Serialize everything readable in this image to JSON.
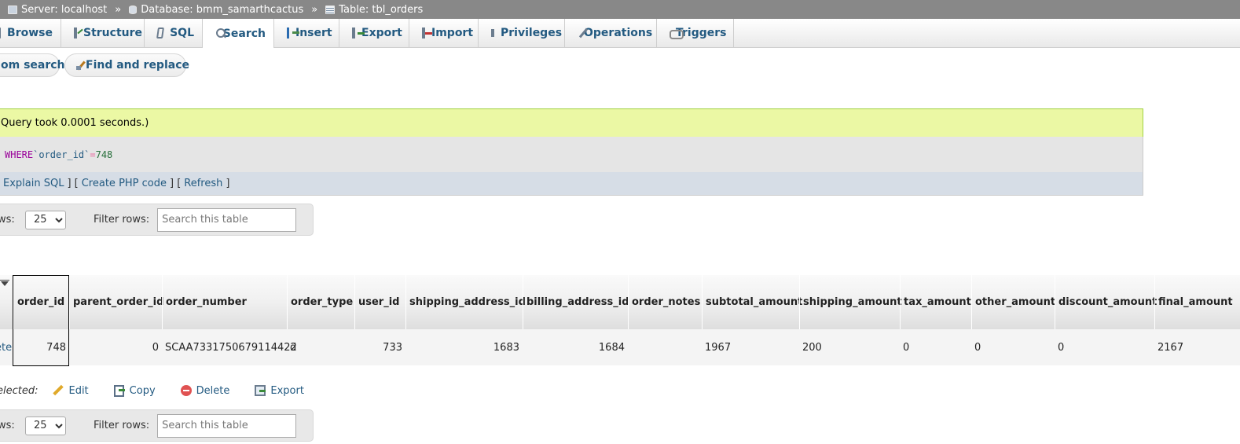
{
  "breadcrumb": {
    "server": "Server: localhost",
    "database": "Database: bmm_samarthcactus",
    "table": "Table: tbl_orders",
    "separator": "»"
  },
  "tabs": [
    {
      "label": "Browse",
      "icon": "browse-icon"
    },
    {
      "label": "Structure",
      "icon": "structure-icon"
    },
    {
      "label": "SQL",
      "icon": "sql-icon"
    },
    {
      "label": "Search",
      "icon": "search-icon",
      "active": true
    },
    {
      "label": "Insert",
      "icon": "insert-icon"
    },
    {
      "label": "Export",
      "icon": "export-icon"
    },
    {
      "label": "Import",
      "icon": "import-icon"
    },
    {
      "label": "Privileges",
      "icon": "privileges-icon"
    },
    {
      "label": "Operations",
      "icon": "operations-icon"
    },
    {
      "label": "Triggers",
      "icon": "triggers-icon"
    }
  ],
  "subnav": {
    "custom_search": "om search",
    "find_replace": "Find and replace"
  },
  "result": {
    "message": "Query took 0.0001 seconds.)",
    "sql_keyword": "WHERE",
    "sql_column": "`order_id`",
    "sql_operator": "=",
    "sql_value": "748",
    "explain": "Explain SQL",
    "create_php": "Create PHP code",
    "refresh": "Refresh",
    "link_sep": "] [",
    "link_end": "]"
  },
  "navbar": {
    "rows_label": "ws:",
    "rows_value": "25",
    "filter_label": "Filter rows:",
    "filter_placeholder": "Search this table"
  },
  "table": {
    "columns": [
      "order_id",
      "parent_order_id",
      "order_number",
      "order_type",
      "user_id",
      "shipping_address_id",
      "billing_address_id",
      "order_notes",
      "subtotal_amount",
      "shipping_amount",
      "tax_amount",
      "other_amount",
      "discount_amount",
      "final_amount"
    ],
    "row": {
      "delete_link": "ete",
      "cells": [
        "748",
        "0",
        "SCAA7331750679114422",
        "d",
        "733",
        "1683",
        "1684",
        "",
        "1967",
        "200",
        "0",
        "0",
        "0",
        "2167"
      ]
    }
  },
  "bulk": {
    "with_selected": "elected:",
    "edit": "Edit",
    "copy": "Copy",
    "delete": "Delete",
    "export": "Export"
  }
}
